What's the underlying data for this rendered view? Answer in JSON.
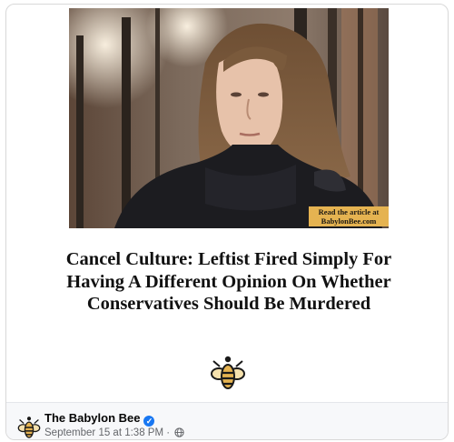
{
  "post": {
    "image_caption_line1": "Read the article at",
    "image_caption_line2": "BabylonBee.com",
    "headline": "Cancel Culture: Leftist Fired Simply For Having A Different Opinion On Whether Conservatives Should Be Murdered",
    "page_name": "The Babylon Bee",
    "timestamp": "September 15 at 1:38 PM",
    "separator": " · ",
    "verified_icon": "verified-badge-icon",
    "audience_icon": "globe-icon",
    "colors": {
      "brand_gold": "#e5b351",
      "verified_blue": "#1877f2",
      "meta_gray": "#65676b"
    }
  }
}
